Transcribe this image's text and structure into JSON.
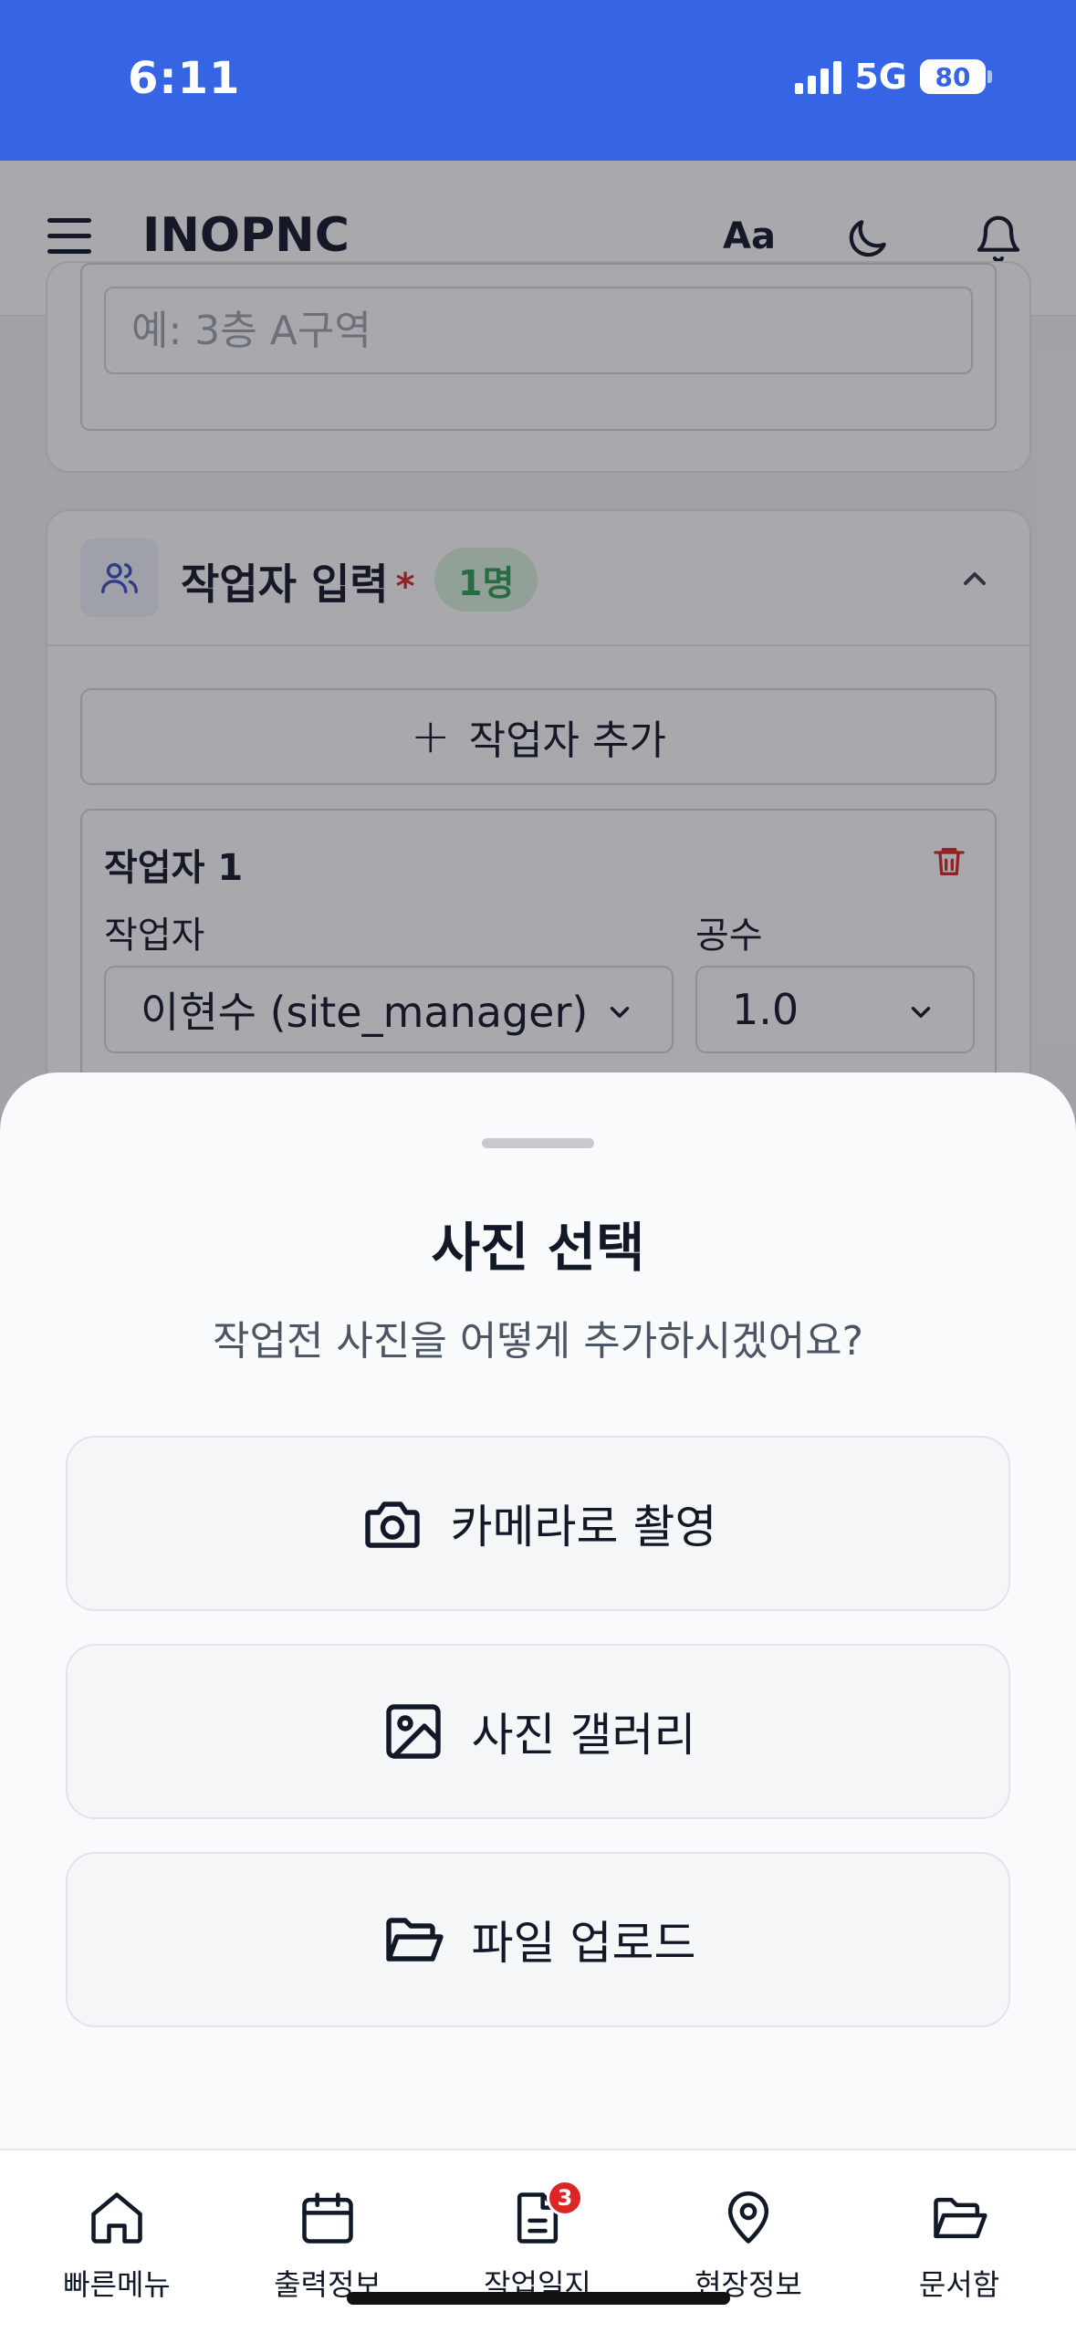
{
  "status_bar": {
    "time": "6:11",
    "network": "5G",
    "battery": "80"
  },
  "header": {
    "brand": "INOPNC",
    "font_size_label": "Aa",
    "icons": [
      "menu-icon",
      "moon-icon",
      "bell-icon"
    ]
  },
  "location_field": {
    "placeholder": "예: 3층 A구역",
    "value": ""
  },
  "workers_section": {
    "title": "작업자 입력",
    "required_mark": "*",
    "count_badge": "1명",
    "add_button": "작업자 추가",
    "add_icon": "+",
    "workers": [
      {
        "title": "작업자 1",
        "worker_label": "작업자",
        "worker_value": "이현수 (site_manager)",
        "hours_label": "공수",
        "hours_value": "1.0"
      }
    ]
  },
  "photo_sheet": {
    "title": "사진 선택",
    "subtitle": "작업전 사진을 어떻게 추가하시겠어요?",
    "options": [
      {
        "label": "카메라로 촬영",
        "icon": "camera-icon"
      },
      {
        "label": "사진 갤러리",
        "icon": "image-icon"
      },
      {
        "label": "파일 업로드",
        "icon": "folder-open-icon"
      }
    ]
  },
  "bottom_nav": {
    "items": [
      {
        "label": "빠른메뉴",
        "icon": "home-icon"
      },
      {
        "label": "출력정보",
        "icon": "calendar-icon"
      },
      {
        "label": "작업일지",
        "icon": "document-icon",
        "badge": "3"
      },
      {
        "label": "현장정보",
        "icon": "map-pin-icon"
      },
      {
        "label": "문서함",
        "icon": "folder-icon"
      }
    ]
  },
  "colors": {
    "status_bar": "#3565e4",
    "badge_green_bg": "#d8f3de",
    "badge_green_text": "#2f9e52",
    "danger": "#dc2626"
  }
}
